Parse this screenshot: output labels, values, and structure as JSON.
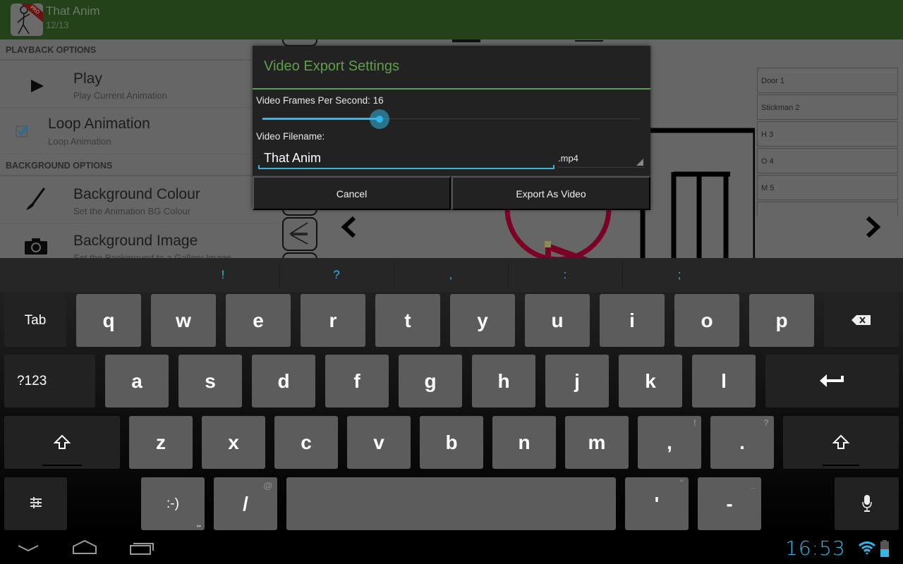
{
  "app": {
    "title": "That Anim",
    "subtitle": "12/13",
    "icon_badge": "PRO"
  },
  "settings": {
    "playback_header": "PLAYBACK OPTIONS",
    "play": {
      "title": "Play",
      "subtitle": "Play Current Animation"
    },
    "loop": {
      "title": "Loop Animation",
      "subtitle": "Loop Animation",
      "checked": true
    },
    "background_header": "BACKGROUND OPTIONS",
    "bg_colour": {
      "title": "Background Colour",
      "subtitle": "Set the Animation BG Colour"
    },
    "bg_image": {
      "title": "Background Image",
      "subtitle": "Set the Background to a Gallery Image"
    }
  },
  "layers": [
    "Door 1",
    "Stickman 2",
    "H 3",
    "O 4",
    "M 5"
  ],
  "dialog": {
    "title": "Video Export Settings",
    "fps_label": "Video Frames Per Second: 16",
    "fps_fraction": 0.31,
    "filename_label": "Video Filename:",
    "filename_value": "That Anim",
    "extension": ".mp4",
    "cancel_label": "Cancel",
    "export_label": "Export As Video"
  },
  "keyboard": {
    "suggestions": [
      "!",
      "?",
      ",",
      ":",
      ";"
    ],
    "row1": [
      "Tab",
      "q",
      "w",
      "e",
      "r",
      "t",
      "y",
      "u",
      "i",
      "o",
      "p"
    ],
    "row2": [
      "?123",
      "a",
      "s",
      "d",
      "f",
      "g",
      "h",
      "j",
      "k",
      "l"
    ],
    "row3": [
      "z",
      "x",
      "c",
      "v",
      "b",
      "n",
      "m",
      ",",
      "."
    ],
    "row3_hints": {
      "comma": "!",
      "period": "?"
    },
    "row4": {
      "emoticon": ":-)",
      "slash": "/",
      "slash_hint": "@",
      "apostrophe": "'",
      "apostrophe_hint": "\"",
      "dash": "-",
      "dash_hint": "_"
    }
  },
  "status": {
    "time": "16:53"
  },
  "colors": {
    "accent": "#33b5e5",
    "dialog_title": "#5d9f4a",
    "appbar": "#24421a"
  }
}
